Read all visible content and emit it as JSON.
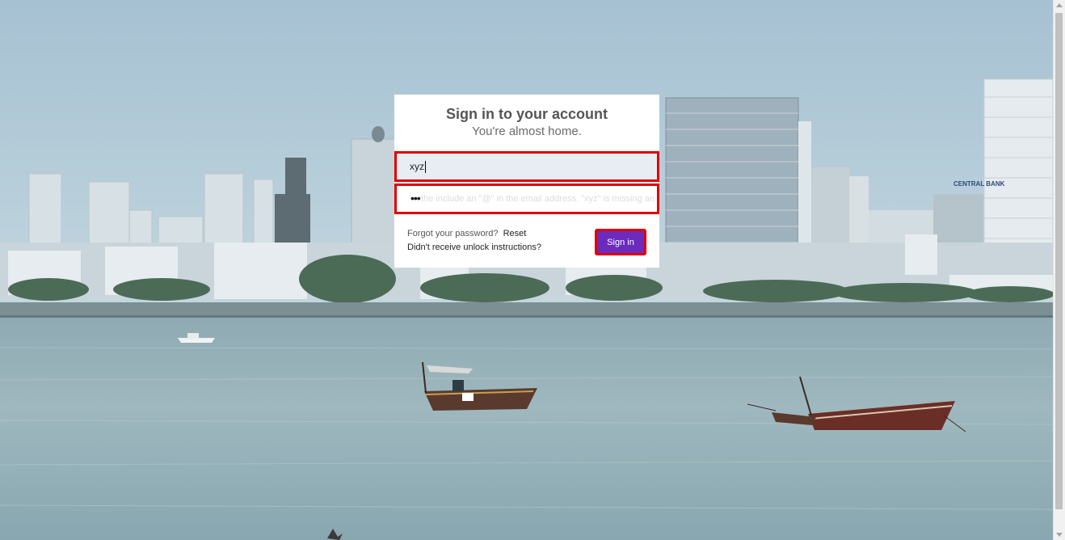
{
  "login": {
    "title": "Sign in to your account",
    "subtitle": "You're almost home.",
    "email_value": "xyz",
    "password_value": "•••",
    "password_hint": "the include an \"@\" in the email address. \"xyz\" is missing an \"@\".",
    "forgot_text": "Forgot your password?",
    "reset_label": "Reset",
    "unlock_label": "Didn't receive unlock instructions?",
    "signin_label": "Sign in"
  },
  "scene": {
    "bank_sign": "CENTRAL BANK"
  },
  "colors": {
    "accent_button": "#6b2bbd",
    "error_outline": "#e00000",
    "card_background": "#ffffff"
  }
}
